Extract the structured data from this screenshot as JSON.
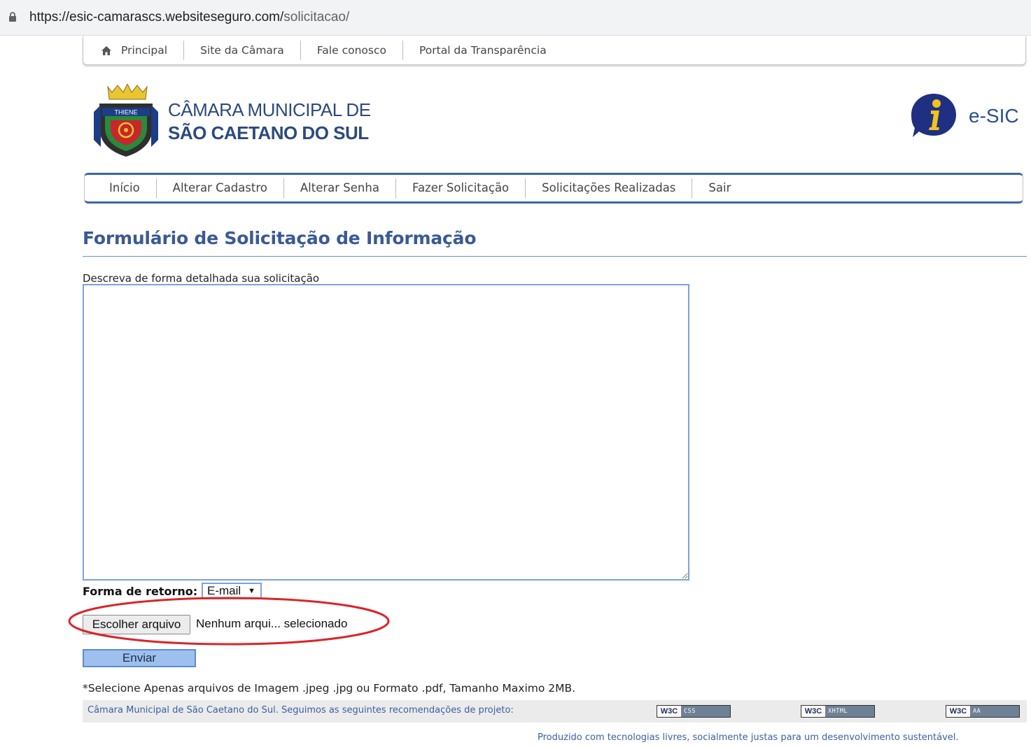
{
  "browser": {
    "url_host": "https://esic-camarascs.websiteseguro.com/",
    "url_path": "solicitacao/"
  },
  "topnav": {
    "items": [
      "Principal",
      "Site da Câmara",
      "Fale conosco",
      "Portal da Transparência"
    ]
  },
  "header": {
    "org_line1": "CÂMARA MUNICIPAL DE",
    "org_line2": "SÃO CAETANO DO SUL",
    "brand": "e-SIC",
    "crest_text": "THIENE"
  },
  "mainnav": {
    "items": [
      "Início",
      "Alterar Cadastro",
      "Alterar Senha",
      "Fazer Solicitação",
      "Solicitações Realizadas",
      "Sair"
    ]
  },
  "form": {
    "title": "Formulário de Solicitação de Informação",
    "desc_label": "Descreva de forma detalhada sua solicitação",
    "desc_value": "",
    "retorno_label": "Forma de retorno:",
    "retorno_selected": "E-mail",
    "file_button": "Escolher arquivo",
    "file_status": "Nenhum arqui... selecionado",
    "submit": "Enviar",
    "note": "*Selecione Apenas arquivos de Imagem .jpeg .jpg ou Formato .pdf, Tamanho Maximo 2MB."
  },
  "footer": {
    "text": "Câmara Municipal de São Caetano do Sul. Seguimos as seguintes recomendações de projeto:",
    "badges": [
      {
        "w3": "W3C",
        "label": "CSS"
      },
      {
        "w3": "W3C",
        "label": "XHTML"
      },
      {
        "w3": "W3C",
        "label": "AA"
      }
    ],
    "produzido": "Produzido com tecnologias livres, socialmente justas para um desenvolvimento sustentável."
  },
  "colors": {
    "brand_blue": "#2c4a7c",
    "title_blue": "#3a5a94",
    "nav_border": "#3a66a8",
    "highlight_red": "#d8262b",
    "submit_bg": "#9ec0ee"
  },
  "icons": [
    "lock-icon",
    "home-icon",
    "crest-logo",
    "info-icon",
    "chevron-down-icon"
  ]
}
